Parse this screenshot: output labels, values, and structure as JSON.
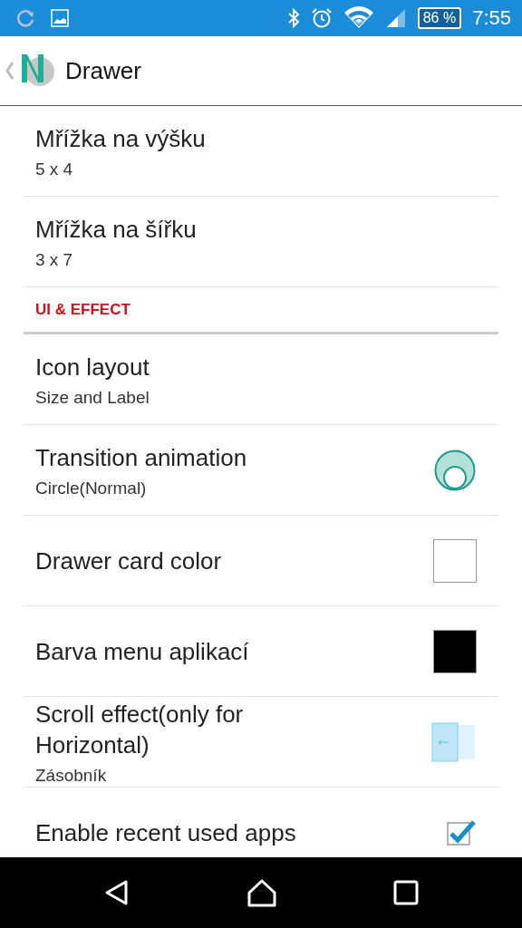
{
  "status_bar": {
    "battery": "86 %",
    "time": "7:55"
  },
  "app_bar": {
    "title": "Drawer"
  },
  "items": [
    {
      "kind": "text",
      "title": "Mřížka na výšku",
      "summary": "5 x 4"
    },
    {
      "kind": "text",
      "title": "Mřížka na šířku",
      "summary": "3 x 7"
    },
    {
      "kind": "header",
      "title": "UI & EFFECT"
    },
    {
      "kind": "text",
      "title": "Icon layout",
      "summary": "Size and Label"
    },
    {
      "kind": "circle",
      "title": "Transition animation",
      "summary": "Circle(Normal)"
    },
    {
      "kind": "color",
      "title": "Drawer card color",
      "color": "#ffffff"
    },
    {
      "kind": "color",
      "title": "Barva menu aplikací",
      "color": "#000000"
    },
    {
      "kind": "scroll",
      "title": "Scroll effect(only for Horizontal)",
      "summary": "Zásobník"
    },
    {
      "kind": "checkbox",
      "title": "Enable recent used apps",
      "checked": true
    }
  ]
}
